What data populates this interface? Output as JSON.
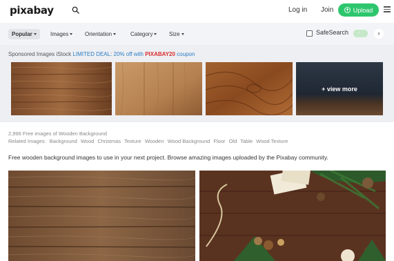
{
  "header": {
    "logo": "pixabay",
    "login": "Log in",
    "join": "Join",
    "upload": "Upload"
  },
  "filters": {
    "popular": "Popular",
    "images": "Images",
    "orientation": "Orientation",
    "category": "Category",
    "size": "Size",
    "safesearch": "SafeSearch",
    "next": "›"
  },
  "sponsored": {
    "label": "Sponsored Images iStock",
    "deal": "LIMITED DEAL: 20% off with",
    "code": "PIXABAY20",
    "coupon": "coupon",
    "more": "+ view more"
  },
  "results": {
    "count": "2,996 Free images of Wooden Background",
    "related_label": "Related Images:",
    "related": [
      "Background",
      "Wood",
      "Christmas",
      "Texture",
      "Wooden",
      "Wood Background",
      "Floor",
      "Old",
      "Table",
      "Wood Texture"
    ],
    "description": "Free wooden background images to use in your next project. Browse amazing images uploaded by the Pixabay community."
  },
  "colors": {
    "accent_green": "#2ec66d",
    "deal_blue": "#2b7cc1",
    "code_red": "#d92c2c"
  }
}
